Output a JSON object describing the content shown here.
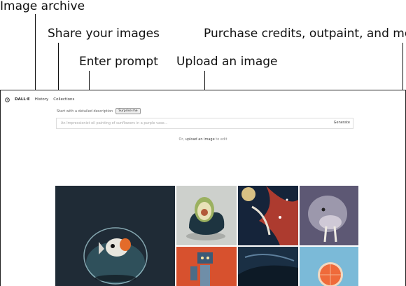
{
  "callouts": {
    "image_archive": "Image archive",
    "share_images": "Share your images",
    "purchase": "Purchase credits, outpaint, and more",
    "enter_prompt": "Enter prompt",
    "upload_image": "Upload an image"
  },
  "nav": {
    "brand": "DALL·E",
    "history": "History",
    "collections": "Collections"
  },
  "prompt": {
    "hint": "Start with a detailed description",
    "surprise": "Surprise me",
    "placeholder": "An Impressionist oil painting of sunflowers in a purple vase...",
    "generate": "Generate"
  },
  "upload": {
    "prefix": "Or,",
    "link": "upload an image",
    "suffix": "to edit"
  },
  "icons": [
    "openai-logo-icon"
  ]
}
